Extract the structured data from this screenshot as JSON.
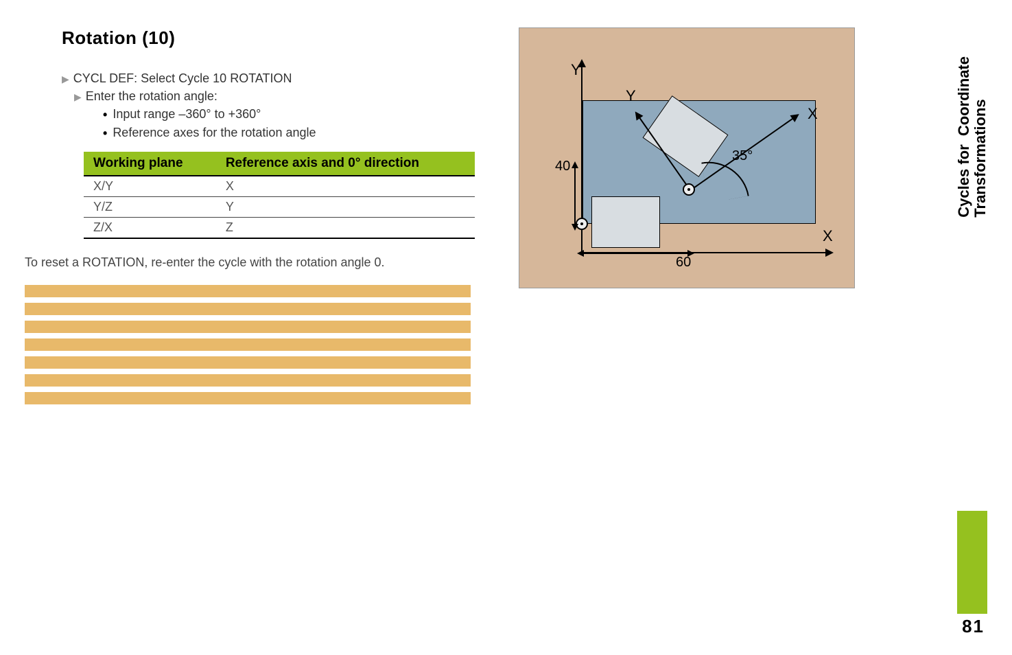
{
  "title": "Rotation  (10)",
  "steps": {
    "cycl_def": "CYCL DEF: Select Cycle 10 ROTATION",
    "enter_angle": "Enter the rotation angle:",
    "bullets": {
      "range": "Input range –360° to +360°",
      "ref": "Reference axes for the rotation angle"
    }
  },
  "table": {
    "header_plane": "Working plane",
    "header_ref": "Reference axis and 0° direction",
    "rows": [
      {
        "plane": "X/Y",
        "axis": "X"
      },
      {
        "plane": "Y/Z",
        "axis": "Y"
      },
      {
        "plane": "Z/X",
        "axis": "Z"
      }
    ]
  },
  "reset_note": "To reset a ROTATION, re-enter the cycle with the rotation angle 0.",
  "code_lines": [
    "",
    "",
    "",
    "",
    "",
    "",
    ""
  ],
  "figure": {
    "y_main": "Y",
    "y_rot": "Y",
    "x_rot": "X",
    "x_main": "X",
    "angle": "35°",
    "dim_y": "40",
    "dim_x": "60"
  },
  "side_tab": "Cycles for  Coordinate\nTransformations",
  "page_number": "81"
}
